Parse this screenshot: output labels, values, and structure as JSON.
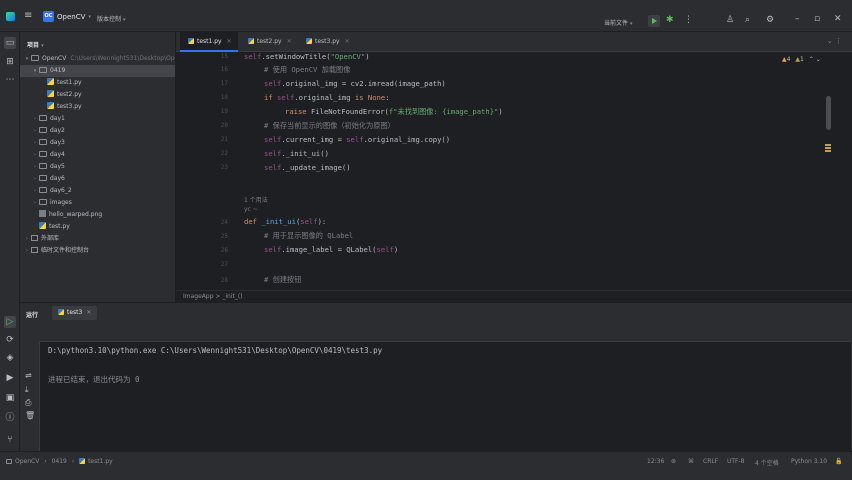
{
  "titlebar": {
    "project_badge": "OC",
    "project_name": "OpenCV",
    "vcs_label": "版本控制",
    "run_config": "当前文件",
    "icons": [
      "hamburger-menu-icon",
      "run-icon",
      "debug-icon",
      "user-icon",
      "search-icon",
      "gear-icon",
      "minimize-icon",
      "restore-icon",
      "close-icon"
    ]
  },
  "project": {
    "header": "项目",
    "tree": [
      {
        "label": "OpenCV",
        "path": "C:\\Users\\Wennight531\\Desktop\\OpenCV",
        "kind": "folder",
        "depth": 0,
        "open": true
      },
      {
        "label": "0419",
        "kind": "folder",
        "depth": 1,
        "open": true,
        "selected": true
      },
      {
        "label": "test1.py",
        "kind": "py",
        "depth": 2
      },
      {
        "label": "test2.py",
        "kind": "py",
        "depth": 2
      },
      {
        "label": "test3.py",
        "kind": "py",
        "depth": 2
      },
      {
        "label": "day1",
        "kind": "folder",
        "depth": 1
      },
      {
        "label": "day2",
        "kind": "folder",
        "depth": 1
      },
      {
        "label": "day3",
        "kind": "folder",
        "depth": 1
      },
      {
        "label": "day4",
        "kind": "folder",
        "depth": 1
      },
      {
        "label": "day5",
        "kind": "folder",
        "depth": 1
      },
      {
        "label": "day6",
        "kind": "folder",
        "depth": 1
      },
      {
        "label": "day6_2",
        "kind": "folder",
        "depth": 1
      },
      {
        "label": "images",
        "kind": "folder",
        "depth": 1
      },
      {
        "label": "hello_warped.png",
        "kind": "img",
        "depth": 1
      },
      {
        "label": "test.py",
        "kind": "py",
        "depth": 1
      },
      {
        "label": "外部库",
        "kind": "lib",
        "depth": 0
      },
      {
        "label": "临时文件和控制台",
        "kind": "lib",
        "depth": 0
      }
    ]
  },
  "editor": {
    "tabs": [
      {
        "label": "test1.py",
        "active": true
      },
      {
        "label": "test2.py",
        "active": false
      },
      {
        "label": "test3.py",
        "active": false
      }
    ],
    "warnings": "4",
    "weak_warnings": "1",
    "line_numbers": [
      "15",
      "16",
      "17",
      "18",
      "19",
      "20",
      "21",
      "22",
      "23",
      "",
      "24",
      "25",
      "26",
      "27",
      "28"
    ],
    "code": {
      "l15_self": "self",
      "l15_rest": ".setWindowTitle(",
      "l15_str": "\"OpenCV\"",
      "l15_end": ")",
      "l16": "# 使用 OpenCV 加载图像",
      "l17_self": "self",
      "l17_rest": ".original_img = cv2.imread(image_path)",
      "l18_if": "if ",
      "l18_self": "self",
      "l18_rest": ".original_img ",
      "l18_is": "is None",
      "l18_colon": ":",
      "l19_raise": "raise ",
      "l19_exc": "FileNotFoundError(",
      "l19_str": "f\"未找到图像: {image_path}\"",
      "l19_end": ")",
      "l20": "# 保存当前显示的图像（初始化为原图）",
      "l21_self": "self",
      "l21_mid": ".current_img = ",
      "l21_self2": "self",
      "l21_end": ".original_img.copy()",
      "l22_self": "self",
      "l22_rest": "._init_ui()",
      "l23_self": "self",
      "l23_rest": "._update_image()",
      "usage_hint": "1 个用法",
      "author_hint": "yc ~",
      "l24_def": "def ",
      "l24_fn": "_init_ui",
      "l24_open": "(",
      "l24_self": "self",
      "l24_close": "):",
      "l25": "# 用于显示图像的 QLabel",
      "l26_self": "self",
      "l26_mid": ".image_label = QLabel(",
      "l26_self2": "self",
      "l26_end": ")",
      "l28": "# 创建按钮"
    },
    "breadcrumb": "ImageApp  >  _init_()"
  },
  "run": {
    "header": "运行",
    "tab_label": "test3",
    "command": "D:\\python3.10\\python.exe C:\\Users\\Wennight531\\Desktop\\OpenCV\\0419\\test3.py",
    "exit_message": "进程已结束，退出代码为 0"
  },
  "statusbar": {
    "crumbs": [
      "OpenCV",
      "0419",
      "test1.py"
    ],
    "position": "12:36",
    "line_sep": "CRLF",
    "encoding": "UTF-8",
    "indent": "4 个空格",
    "interpreter": "Python 3.10"
  },
  "colors": {
    "accent": "#3574f0",
    "keyword": "#cf8e6d",
    "string": "#6aab73",
    "self": "#94558d",
    "comment": "#7a7e85",
    "doc_comment": "#5f826b",
    "function": "#56a8f5",
    "warning": "#e9a24d"
  }
}
